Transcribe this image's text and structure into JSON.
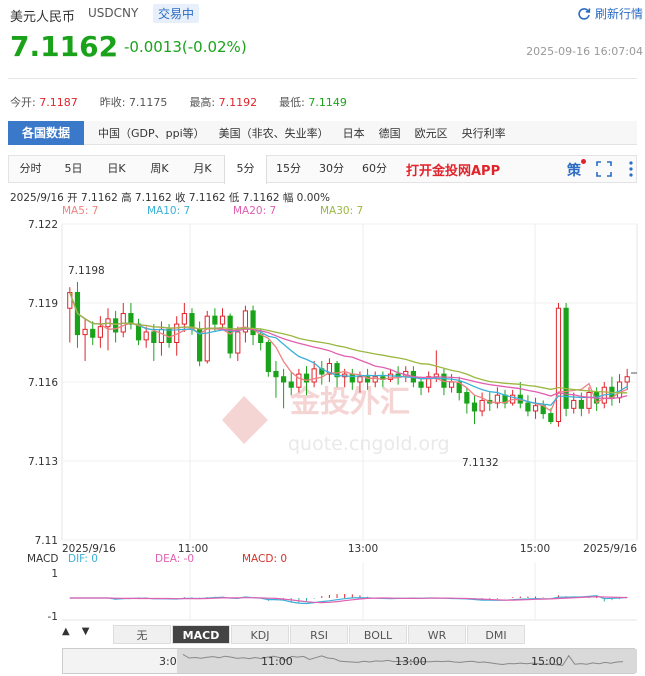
{
  "header": {
    "name": "美元人民币",
    "code": "USDCNY",
    "status": "交易中",
    "refresh": "刷新行情",
    "price": "7.1162",
    "change": "-0.0013(-0.02%)",
    "datetime": "2025-09-16 16:07:04"
  },
  "stats": [
    {
      "label": "今开:",
      "value": "7.1187",
      "color": "red"
    },
    {
      "label": "昨收:",
      "value": "7.1175",
      "color": "plain"
    },
    {
      "label": "最高:",
      "value": "7.1192",
      "color": "red"
    },
    {
      "label": "最低:",
      "value": "7.1149",
      "color": "green"
    }
  ],
  "category_tabs": {
    "active": "各国数据",
    "items": [
      "中国（GDP、ppi等）",
      "美国（非农、失业率）",
      "日本",
      "德国",
      "欧元区",
      "央行利率"
    ]
  },
  "period_tabs": {
    "items": [
      "分时",
      "5日",
      "日K",
      "周K",
      "月K",
      "5分",
      "15分",
      "30分",
      "60分"
    ],
    "selected": "5分",
    "app": "打开金投网APP",
    "strategy": "策"
  },
  "ohlc": "2025/9/16  开 7.1162  高 7.1162  收 7.1162  低 7.1162  幅 0.00%",
  "ma_legend": [
    {
      "text": "MA5: 7",
      "color": "#f08080"
    },
    {
      "text": "MA10: 7",
      "color": "#3bb0d8"
    },
    {
      "text": "MA20: 7",
      "color": "#e05fb0"
    },
    {
      "text": "MA30: 7",
      "color": "#9ab840"
    }
  ],
  "chart_data": {
    "type": "candlestick",
    "y_ticks": [
      "7.122",
      "7.119",
      "7.116",
      "7.113",
      "7.11"
    ],
    "ylim": [
      7.11,
      7.122
    ],
    "x_ticks": [
      "2025/9/16",
      "11:00",
      "13:00",
      "15:00",
      "2025/9/16"
    ],
    "annotations": {
      "high": "7.1198",
      "low": "7.1132"
    },
    "watermark_brand": "金投外汇",
    "watermark_url": "quote.cngold.org",
    "candles": [
      [
        7.1188,
        7.1194,
        7.1196,
        7.1175
      ],
      [
        7.1194,
        7.1178,
        7.1198,
        7.1173
      ],
      [
        7.1178,
        7.118,
        7.1184,
        7.1168
      ],
      [
        7.118,
        7.1177,
        7.1183,
        7.1174
      ],
      [
        7.1177,
        7.1181,
        7.1185,
        7.1173
      ],
      [
        7.1181,
        7.1184,
        7.1188,
        7.1172
      ],
      [
        7.1184,
        7.1179,
        7.1187,
        7.1175
      ],
      [
        7.1179,
        7.1186,
        7.119,
        7.1177
      ],
      [
        7.1186,
        7.1182,
        7.119,
        7.118
      ],
      [
        7.1182,
        7.1176,
        7.1184,
        7.1174
      ],
      [
        7.1176,
        7.1179,
        7.1181,
        7.1173
      ],
      [
        7.1179,
        7.1175,
        7.1182,
        7.1168
      ],
      [
        7.1175,
        7.118,
        7.1183,
        7.117
      ],
      [
        7.118,
        7.1175,
        7.1182,
        7.1173
      ],
      [
        7.1175,
        7.1182,
        7.1185,
        7.117
      ],
      [
        7.1182,
        7.1186,
        7.119,
        7.1179
      ],
      [
        7.1186,
        7.118,
        7.1188,
        7.1178
      ],
      [
        7.118,
        7.1168,
        7.1183,
        7.1166
      ],
      [
        7.1168,
        7.1185,
        7.1187,
        7.1167
      ],
      [
        7.1185,
        7.1182,
        7.1188,
        7.1179
      ],
      [
        7.1182,
        7.1185,
        7.1188,
        7.118
      ],
      [
        7.1185,
        7.1171,
        7.1186,
        7.1169
      ],
      [
        7.1171,
        7.1179,
        7.1181,
        7.1168
      ],
      [
        7.1179,
        7.1187,
        7.1189,
        7.1175
      ],
      [
        7.1187,
        7.1178,
        7.1189,
        7.1174
      ],
      [
        7.1178,
        7.1175,
        7.118,
        7.1172
      ],
      [
        7.1175,
        7.1164,
        7.1176,
        7.1162
      ],
      [
        7.1164,
        7.1162,
        7.1168,
        7.1154
      ],
      [
        7.1162,
        7.116,
        7.1165,
        7.115
      ],
      [
        7.116,
        7.1158,
        7.1164,
        7.1155
      ],
      [
        7.1158,
        7.1163,
        7.1165,
        7.1156
      ],
      [
        7.1163,
        7.116,
        7.1166,
        7.1155
      ],
      [
        7.116,
        7.1165,
        7.1168,
        7.1158
      ],
      [
        7.1165,
        7.1163,
        7.1168,
        7.1159
      ],
      [
        7.1163,
        7.1167,
        7.1169,
        7.116
      ],
      [
        7.1167,
        7.1162,
        7.1168,
        7.1158
      ],
      [
        7.1162,
        7.1163,
        7.1165,
        7.1158
      ],
      [
        7.1163,
        7.116,
        7.1165,
        7.1157
      ],
      [
        7.116,
        7.1162,
        7.1164,
        7.1156
      ],
      [
        7.1162,
        7.116,
        7.1165,
        7.1157
      ],
      [
        7.116,
        7.1162,
        7.1164,
        7.1158
      ],
      [
        7.1162,
        7.1161,
        7.1164,
        7.1158
      ],
      [
        7.1161,
        7.1163,
        7.1165,
        7.116
      ],
      [
        7.1163,
        7.1162,
        7.1166,
        7.1159
      ],
      [
        7.1162,
        7.1164,
        7.1166,
        7.116
      ],
      [
        7.1164,
        7.116,
        7.1166,
        7.1158
      ],
      [
        7.116,
        7.1158,
        7.1162,
        7.1155
      ],
      [
        7.1158,
        7.1162,
        7.1164,
        7.1156
      ],
      [
        7.1162,
        7.1163,
        7.1172,
        7.116
      ],
      [
        7.1163,
        7.1158,
        7.1165,
        7.1155
      ],
      [
        7.1158,
        7.116,
        7.1163,
        7.1156
      ],
      [
        7.116,
        7.1156,
        7.1162,
        7.1153
      ],
      [
        7.1156,
        7.1152,
        7.1158,
        7.1148
      ],
      [
        7.1152,
        7.1149,
        7.1155,
        7.1144
      ],
      [
        7.1149,
        7.1153,
        7.1156,
        7.1147
      ],
      [
        7.1153,
        7.1152,
        7.1156,
        7.1149
      ],
      [
        7.1152,
        7.1155,
        7.1158,
        7.115
      ],
      [
        7.1155,
        7.1152,
        7.1157,
        7.115
      ],
      [
        7.1152,
        7.1155,
        7.1157,
        7.1151
      ],
      [
        7.1155,
        7.1152,
        7.116,
        7.115
      ],
      [
        7.1152,
        7.1149,
        7.1155,
        7.1147
      ],
      [
        7.1149,
        7.1151,
        7.1154,
        7.1146
      ],
      [
        7.1151,
        7.1148,
        7.1153,
        7.1146
      ],
      [
        7.1148,
        7.1145,
        7.115,
        7.1144
      ],
      [
        7.1145,
        7.1188,
        7.119,
        7.1143
      ],
      [
        7.1188,
        7.115,
        7.119,
        7.1147
      ],
      [
        7.115,
        7.1153,
        7.1156,
        7.1148
      ],
      [
        7.1153,
        7.115,
        7.1156,
        7.1147
      ],
      [
        7.115,
        7.1156,
        7.1158,
        7.1148
      ],
      [
        7.1156,
        7.1152,
        7.1158,
        7.1149
      ],
      [
        7.1152,
        7.1158,
        7.116,
        7.115
      ],
      [
        7.1158,
        7.1154,
        7.1162,
        7.1151
      ],
      [
        7.1154,
        7.116,
        7.1163,
        7.1152
      ],
      [
        7.116,
        7.1162,
        7.1165,
        7.1157
      ]
    ],
    "ma_series": [
      "MA5",
      "MA10",
      "MA20",
      "MA30"
    ]
  },
  "macd": {
    "title": "MACD",
    "dif": "DIF: 0",
    "dea": "DEA: -0",
    "macd": "MACD: 0",
    "y_ticks": [
      "1",
      "-1"
    ]
  },
  "indicator_tabs": {
    "items": [
      "无",
      "MACD",
      "KDJ",
      "RSI",
      "BOLL",
      "WR",
      "DMI"
    ],
    "selected": "MACD"
  },
  "navigator": {
    "labels": [
      "3:0",
      "11:00",
      "13:00",
      "15:00"
    ]
  }
}
